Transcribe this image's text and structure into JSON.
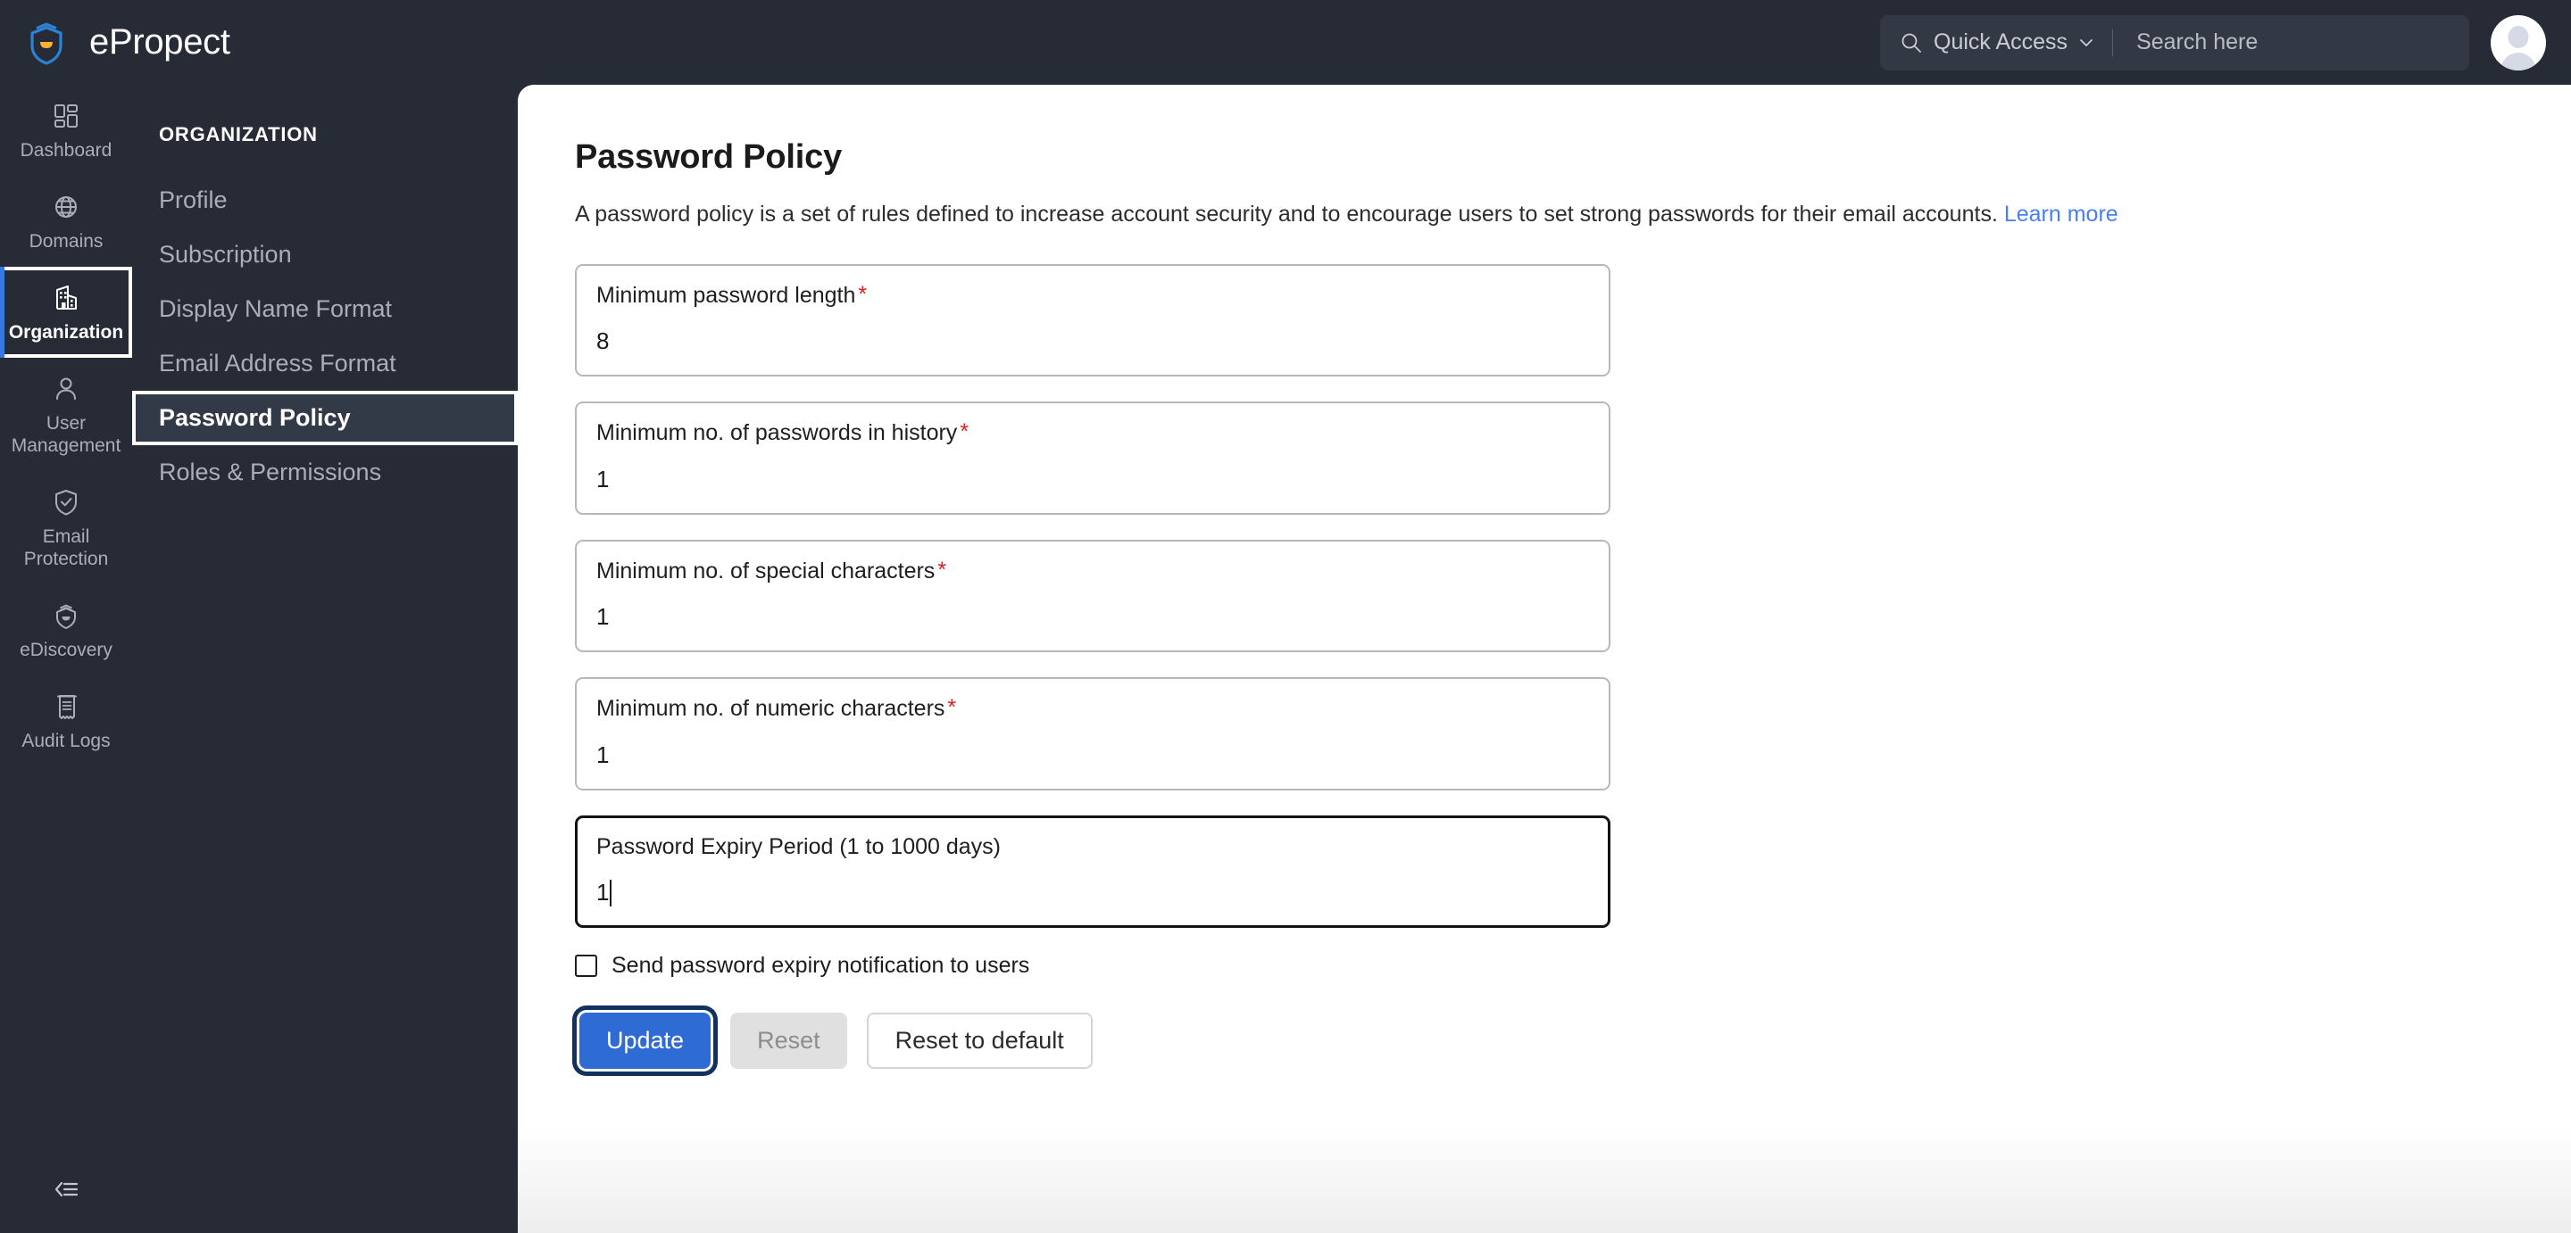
{
  "app": {
    "brand_name": "ePropect",
    "logo_icon": "shield-smile-logo"
  },
  "header": {
    "quick_access_label": "Quick Access",
    "quick_access_icon": "search-icon",
    "caret_icon": "chevron-down-icon",
    "search_placeholder": "Search here",
    "search_value": "",
    "avatar_icon": "user-avatar"
  },
  "rail": {
    "items": [
      {
        "label": "Dashboard",
        "icon": "dashboard-grid-icon",
        "active": false,
        "focused": false
      },
      {
        "label": "Domains",
        "icon": "globe-icon",
        "active": false,
        "focused": false
      },
      {
        "label": "Organization",
        "icon": "building-icon",
        "active": true,
        "focused": true
      },
      {
        "label": "User Management",
        "icon": "user-icon",
        "active": false,
        "focused": false
      },
      {
        "label": "Email Protection",
        "icon": "shield-check-icon",
        "active": false,
        "focused": false
      },
      {
        "label": "eDiscovery",
        "icon": "helmet-icon",
        "active": false,
        "focused": false
      },
      {
        "label": "Audit Logs",
        "icon": "document-list-icon",
        "active": false,
        "focused": false
      }
    ],
    "collapse_icon": "collapse-sidebar-icon"
  },
  "subnav": {
    "title": "ORGANIZATION",
    "items": [
      {
        "label": "Profile",
        "active": false,
        "focused": false
      },
      {
        "label": "Subscription",
        "active": false,
        "focused": false
      },
      {
        "label": "Display Name Format",
        "active": false,
        "focused": false
      },
      {
        "label": "Email Address Format",
        "active": false,
        "focused": false
      },
      {
        "label": "Password Policy",
        "active": true,
        "focused": true
      },
      {
        "label": "Roles & Permissions",
        "active": false,
        "focused": false
      }
    ]
  },
  "main": {
    "title": "Password Policy",
    "description": "A password policy is a set of rules defined to increase account security and to encourage users to set strong passwords for their email accounts.",
    "learn_more_label": "Learn more",
    "fields": [
      {
        "label": "Minimum password length",
        "required": true,
        "value": "8",
        "focused": false
      },
      {
        "label": "Minimum no. of passwords in history",
        "required": true,
        "value": "1",
        "focused": false
      },
      {
        "label": "Minimum no. of special characters",
        "required": true,
        "value": "1",
        "focused": false
      },
      {
        "label": "Minimum no. of numeric characters",
        "required": true,
        "value": "1",
        "focused": false
      },
      {
        "label": "Password Expiry Period (1 to 1000 days)",
        "required": false,
        "value": "1",
        "focused": true
      }
    ],
    "checkbox": {
      "label": "Send password expiry notification to users",
      "checked": false
    },
    "buttons": {
      "update": "Update",
      "reset": "Reset",
      "reset_default": "Reset to default"
    }
  },
  "colors": {
    "sidebar_bg": "#262b36",
    "subnav_active_bg": "#333a47",
    "primary_blue": "#2f6bd4",
    "focus_navy": "#12315e",
    "link_blue": "#4a7ff0",
    "required_red": "#e02020",
    "accent_blue": "#3778e0"
  }
}
